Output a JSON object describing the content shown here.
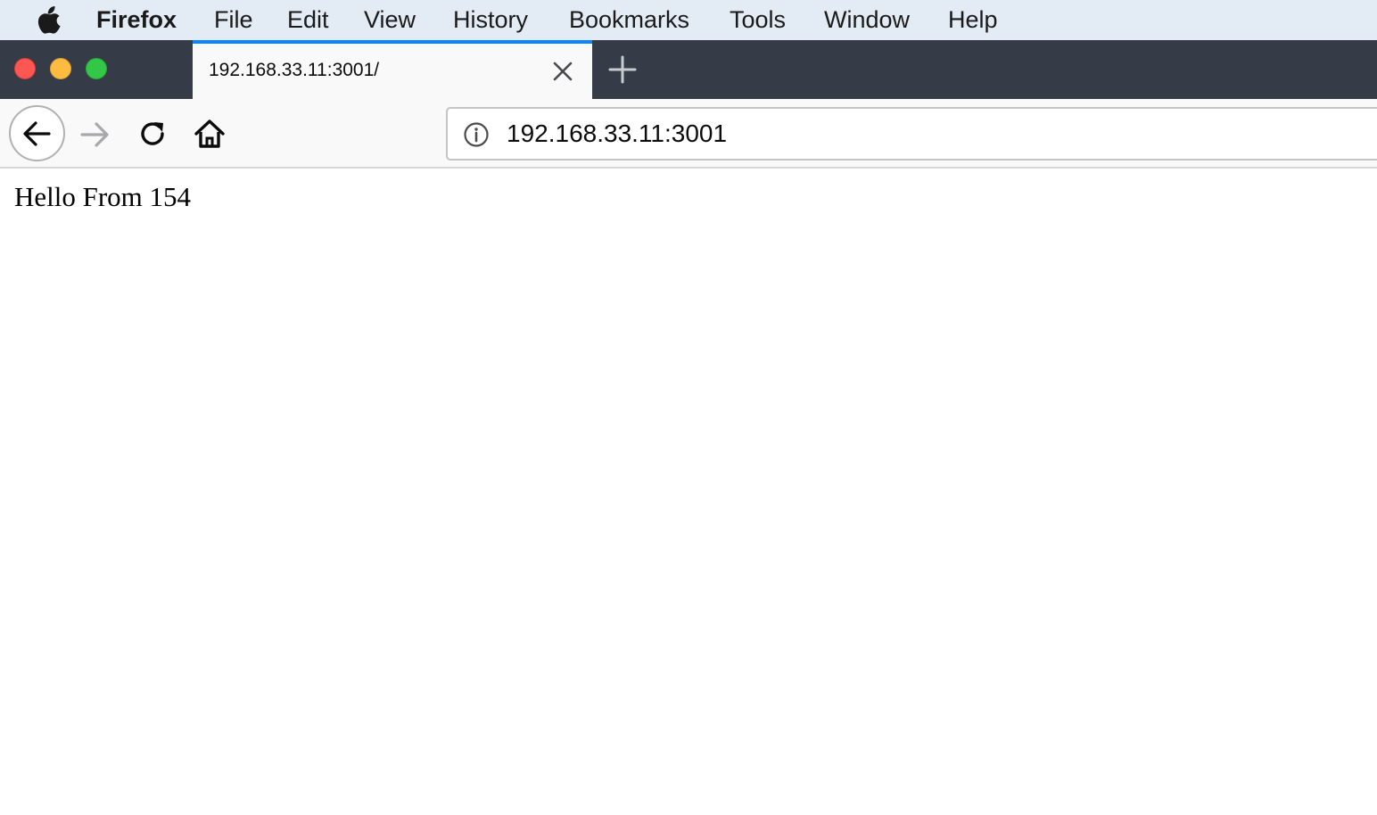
{
  "menubar": {
    "app_name": "Firefox",
    "items": [
      "File",
      "Edit",
      "View",
      "History",
      "Bookmarks",
      "Tools",
      "Window",
      "Help"
    ]
  },
  "tab": {
    "title": "192.168.33.11:3001/"
  },
  "urlbar": {
    "url": "192.168.33.11:3001"
  },
  "page": {
    "text": "Hello From 154"
  },
  "colors": {
    "menubar_bg": "#e3ebf4",
    "tabstrip_bg": "#353c47",
    "tab_accent": "#0a84ff",
    "toolbar_bg": "#f9f9fa",
    "close_button": "#fc5753",
    "minimize_button": "#fdbc40",
    "maximize_button": "#33c748"
  },
  "icons": [
    "apple-icon",
    "close-icon",
    "plus-icon",
    "back-arrow-icon",
    "forward-arrow-icon",
    "reload-icon",
    "home-icon",
    "info-icon"
  ]
}
